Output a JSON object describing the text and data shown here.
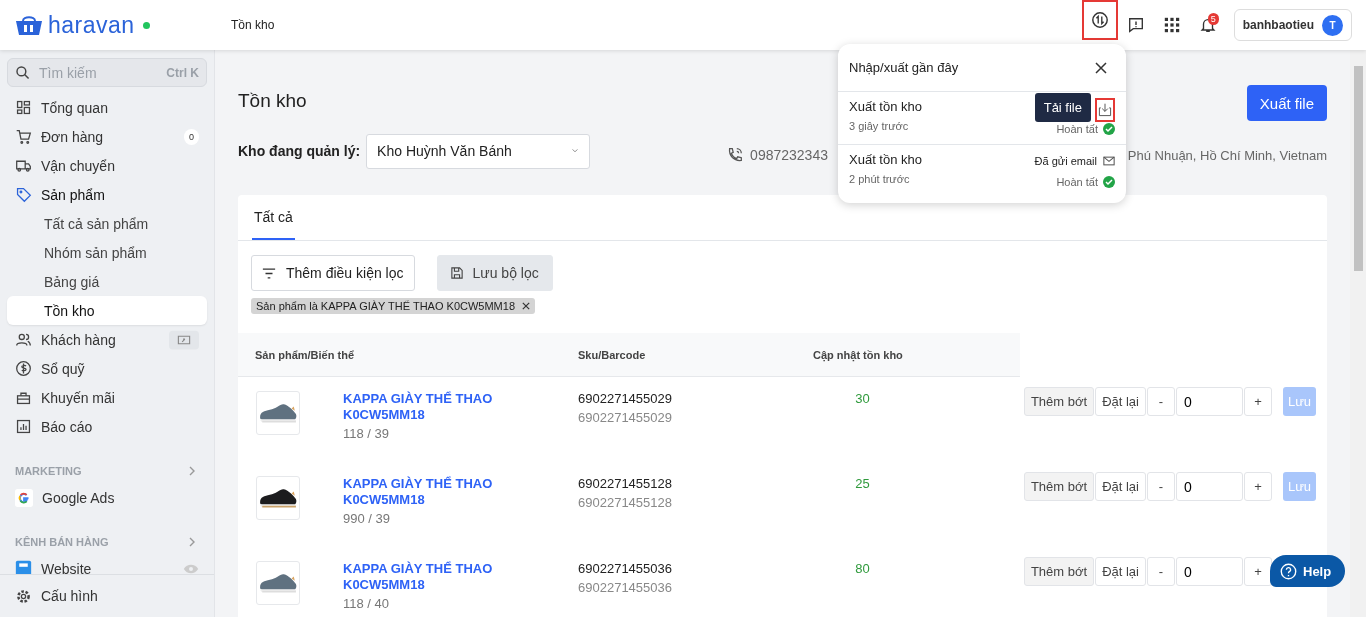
{
  "topbar": {
    "brand": "haravan",
    "breadcrumb": "Tồn kho",
    "actions": [
      {
        "kind": "sync",
        "highlighted": true
      },
      {
        "kind": "feedback",
        "highlighted": false
      },
      {
        "kind": "apps",
        "highlighted": false
      },
      {
        "kind": "bell",
        "highlighted": false,
        "badge": "5"
      }
    ],
    "user": {
      "name": "banhbaotieu",
      "initial": "T"
    }
  },
  "sidebar": {
    "search": {
      "placeholder": "Tìm kiếm",
      "shortcut": "Ctrl K"
    },
    "items": [
      {
        "label": "Tổng quan",
        "selected": false
      },
      {
        "label": "Đơn hàng",
        "selected": false,
        "badge": "0"
      },
      {
        "label": "Vận chuyển",
        "selected": false
      },
      {
        "label": "Sản phẩm",
        "selected": false,
        "expanded": true,
        "children": [
          {
            "label": "Tất cả sản phẩm",
            "selected": false
          },
          {
            "label": "Nhóm sản phẩm",
            "selected": false
          },
          {
            "label": "Bảng giá",
            "selected": false
          },
          {
            "label": "Tồn kho",
            "selected": true
          }
        ]
      },
      {
        "label": "Khách hàng",
        "selected": false,
        "extra": true
      },
      {
        "label": "Sổ quỹ",
        "selected": false
      },
      {
        "label": "Khuyến mãi",
        "selected": false
      },
      {
        "label": "Báo cáo",
        "selected": false
      }
    ],
    "sections": [
      {
        "title": "MARKETING",
        "items": [
          {
            "label": "Google Ads",
            "selected": false
          }
        ]
      },
      {
        "title": "KÊNH BÁN HÀNG",
        "items": [
          {
            "label": "Website",
            "selected": false
          }
        ]
      }
    ],
    "footer": "Cấu hình"
  },
  "page": {
    "title": "Tồn kho",
    "export_button": "Xuất file",
    "warehouse_label": "Kho đang quản lý:",
    "warehouse": "Kho Huỳnh Văn Bánh",
    "phone": "0987232343",
    "address": "Phú Nhuận, Hồ Chí Minh, Vietnam"
  },
  "tabs": [
    {
      "label": "Tất cả",
      "selected": true
    }
  ],
  "filters": {
    "add": "Thêm điều kiện lọc",
    "save": "Lưu bộ lọc",
    "chips": [
      "Sản phẩm là KAPPA GIÀY THỂ THAO K0CW5MM18"
    ]
  },
  "table": {
    "columns": [
      "Sản phẩm/Biến thể",
      "Sku/Barcode",
      "Cập nhật tồn kho"
    ],
    "rows": [
      {
        "name": "KAPPA GIÀY THỂ THAO K0CW5MM18",
        "variant": "118 / 39",
        "sku": "6902271455029",
        "barcode": "6902271455029",
        "stock": "30",
        "modes": [
          {
            "label": "Thêm bớt",
            "selected": true
          },
          {
            "label": "Đặt lại",
            "selected": false
          }
        ],
        "minus": "-",
        "value": "0",
        "plus": "+",
        "save": {
          "label": "Lưu",
          "disabled": true
        }
      },
      {
        "name": "KAPPA GIÀY THỂ THAO K0CW5MM18",
        "variant": "990 / 39",
        "sku": "6902271455128",
        "barcode": "6902271455128",
        "stock": "25",
        "modes": [
          {
            "label": "Thêm bớt",
            "selected": true
          },
          {
            "label": "Đặt lại",
            "selected": false
          }
        ],
        "minus": "-",
        "value": "0",
        "plus": "+",
        "save": {
          "label": "Lưu",
          "disabled": true
        }
      },
      {
        "name": "KAPPA GIÀY THỂ THAO K0CW5MM18",
        "variant": "118 / 40",
        "sku": "6902271455036",
        "barcode": "6902271455036",
        "stock": "80",
        "modes": [
          {
            "label": "Thêm bớt",
            "selected": true
          },
          {
            "label": "Đặt lại",
            "selected": false
          }
        ],
        "minus": "-",
        "value": "0",
        "plus": "+"
      }
    ]
  },
  "popover": {
    "title": "Nhập/xuất gần đây",
    "items": [
      {
        "title": "Xuất tồn kho",
        "time": "3 giây trước",
        "status": "Hoàn tất",
        "action": {
          "kind": "download",
          "tooltip": "Tải file",
          "highlighted": true
        }
      },
      {
        "title": "Xuất tồn kho",
        "time": "2 phút trước",
        "status": "Hoàn tất",
        "action": {
          "kind": "email",
          "label": "Đã gửi email"
        }
      }
    ]
  },
  "help": "Help"
}
